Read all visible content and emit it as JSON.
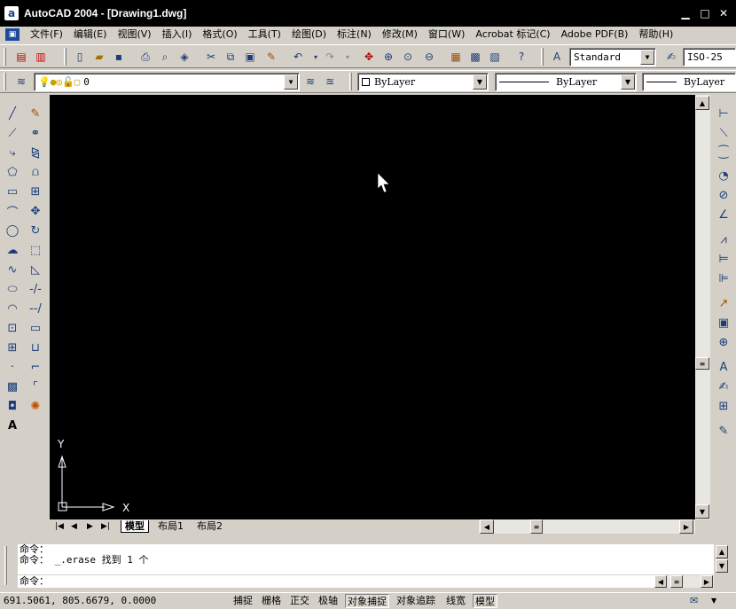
{
  "window": {
    "title": "AutoCAD 2004 - [Drawing1.dwg]",
    "app_icon": "a",
    "minimize": "▁",
    "maximize": "□",
    "close": "✕"
  },
  "menu": [
    "文件(F)",
    "编辑(E)",
    "视图(V)",
    "插入(I)",
    "格式(O)",
    "工具(T)",
    "绘图(D)",
    "标注(N)",
    "修改(M)",
    "窗口(W)",
    "Acrobat 标记(C)",
    "Adobe PDF(B)",
    "帮助(H)"
  ],
  "toolbar": {
    "text_style": "Standard",
    "dim_style": "ISO-25"
  },
  "layers": {
    "layer_name": "0",
    "color": "ByLayer",
    "linetype": "ByLayer",
    "lineweight": "ByLayer"
  },
  "canvas": {
    "background": "#000000",
    "ucs_x": "X",
    "ucs_y": "Y"
  },
  "tabs": [
    "模型",
    "布局1",
    "布局2"
  ],
  "command": {
    "line1": "命令：",
    "line2": "命令：  _.erase 找到 1 个",
    "prompt": "命令："
  },
  "status": {
    "coords": "691.5061,  805.6679,  0.0000",
    "buttons": [
      "捕捉",
      "栅格",
      "正交",
      "极轴",
      "对象捕捉",
      "对象追踪",
      "线宽",
      "模型"
    ]
  }
}
